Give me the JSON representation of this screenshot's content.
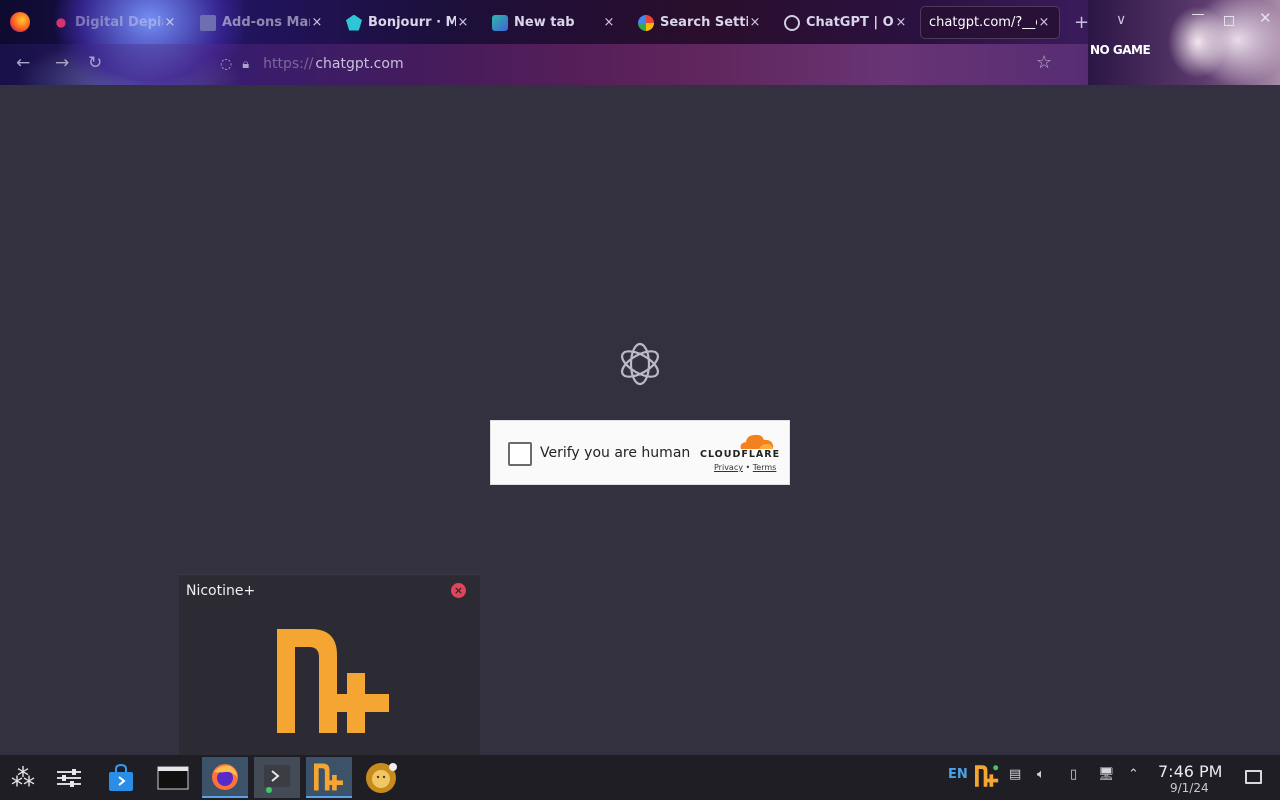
{
  "browser": {
    "tabs": [
      {
        "title": "Digital Depiat",
        "icon": "pink-dot-icon",
        "close": "×"
      },
      {
        "title": "Add-ons Mana",
        "icon": "puzzle-icon",
        "close": "×"
      },
      {
        "title": "Bonjourr · Mi",
        "icon": "bonjourr-icon",
        "close": "×"
      },
      {
        "title": "New tab",
        "icon": "new-tab-icon",
        "close": "×"
      },
      {
        "title": "Search Settin",
        "icon": "google-icon",
        "close": "×"
      },
      {
        "title": "ChatGPT | Op",
        "icon": "openai-icon",
        "close": "×"
      },
      {
        "title": "chatgpt.com/?__c",
        "icon": "",
        "close": "×",
        "active": true
      }
    ],
    "new_tab_glyph": "+",
    "tab_list_glyph": "∨",
    "url_scheme": "https://",
    "url_host": "chatgpt.com",
    "theme_caption": "NO GAME",
    "window_close_glyph": "✕"
  },
  "page": {
    "turnstile": {
      "label": "Verify you are human",
      "brand": "CLOUDFLARE",
      "privacy": "Privacy",
      "separator": "•",
      "terms": "Terms"
    }
  },
  "preview": {
    "title": "Nicotine+",
    "close_glyph": "×"
  },
  "taskbar": {
    "apps": [
      "application-launcher",
      "system-settings",
      "discover-store",
      "terminal-window",
      "firefox",
      "konsole",
      "nicotine-plus",
      "lion-app"
    ],
    "tray": {
      "language": "EN"
    },
    "clock": {
      "time": "7:46 PM",
      "date": "9/1/24"
    }
  },
  "colors": {
    "page_bg": "#33313f",
    "taskbar_bg": "#1f1e24",
    "nicotine_orange": "#f5a531",
    "cloudflare_orange": "#f48120",
    "active_task": "#3b5269"
  }
}
